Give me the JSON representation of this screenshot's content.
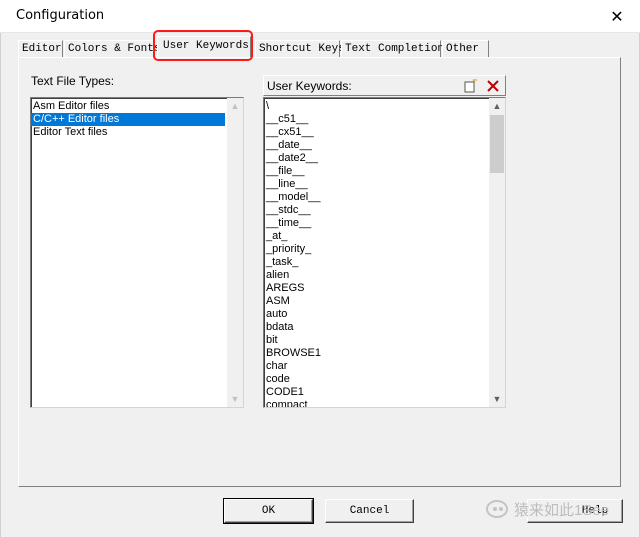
{
  "window": {
    "title": "Configuration",
    "close_glyph": "✕"
  },
  "tabs": [
    {
      "label": "Editor",
      "active": false
    },
    {
      "label": "Colors & Fonts",
      "active": false
    },
    {
      "label": "User Keywords",
      "active": true
    },
    {
      "label": "Shortcut Keys",
      "active": false
    },
    {
      "label": "Text Completion",
      "active": false
    },
    {
      "label": "Other",
      "active": false
    }
  ],
  "file_types": {
    "label": "Text File Types:",
    "items": [
      "Asm Editor files",
      "C/C++ Editor files",
      "Editor Text files"
    ],
    "selected_index": 1
  },
  "keywords": {
    "label": "User Keywords:",
    "new_icon": "new-item-icon",
    "delete_icon": "delete-icon",
    "items": [
      "\\",
      "__c51__",
      "__cx51__",
      "__date__",
      "__date2__",
      "__file__",
      "__line__",
      "__model__",
      "__stdc__",
      "__time__",
      "_at_",
      "_priority_",
      "_task_",
      "alien",
      "AREGS",
      "ASM",
      "auto",
      "bdata",
      "bit",
      "BROWSE1",
      "char",
      "code",
      "CODE1",
      "compact"
    ]
  },
  "buttons": {
    "ok": "OK",
    "cancel": "Cancel",
    "help": "Help"
  },
  "highlight_color": "#ff1a1a",
  "selection_color": "#0078d7",
  "watermark": {
    "text": "猿来如此1See"
  }
}
